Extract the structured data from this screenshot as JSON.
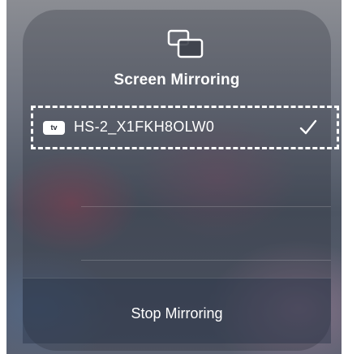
{
  "panel": {
    "title": "Screen Mirroring",
    "icon": "screen-mirroring-icon"
  },
  "device": {
    "badge_label": "tv",
    "badge_icon": "apple-tv-icon",
    "name": "HS-2_X1FKH8OLW0",
    "selected": true,
    "check_icon": "checkmark-icon"
  },
  "footer": {
    "label": "Stop Mirroring"
  },
  "colors": {
    "text": "#ffffff",
    "highlight_border": "#ffffff"
  }
}
